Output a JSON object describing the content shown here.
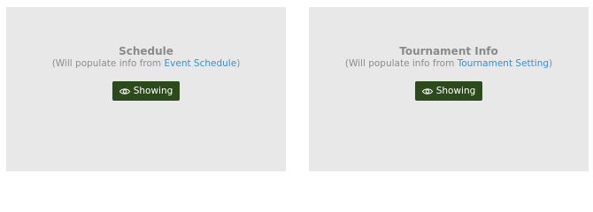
{
  "cards": [
    {
      "title": "Schedule",
      "subtitle_prefix": "(Will populate info from ",
      "link_text": "Event Schedule",
      "subtitle_suffix": ")",
      "button_label": "Showing",
      "button_icon": "eye-icon"
    },
    {
      "title": "Tournament Info",
      "subtitle_prefix": "(Will populate info from ",
      "link_text": "Tournament Setting",
      "subtitle_suffix": ")",
      "button_label": "Showing",
      "button_icon": "eye-icon"
    }
  ],
  "colors": {
    "card_bg": "#e8e8e8",
    "title": "#8a8a8a",
    "link": "#3a8fc6",
    "button_bg": "#2c4a1c",
    "button_text": "#ffffff"
  }
}
